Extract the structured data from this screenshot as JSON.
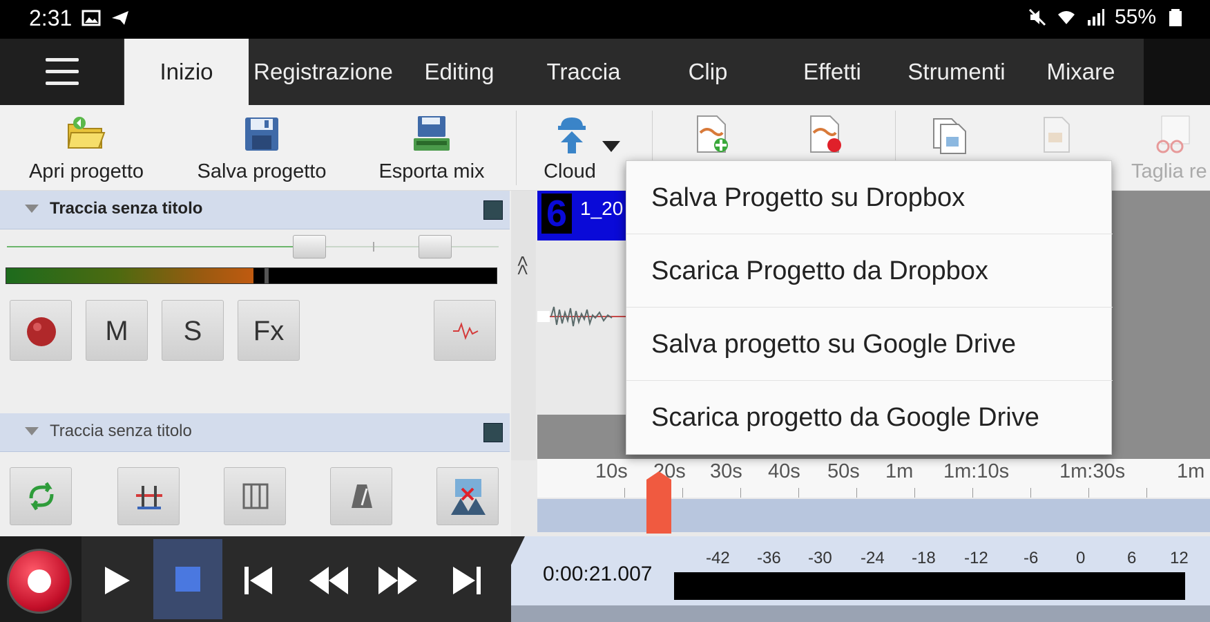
{
  "status_bar": {
    "time": "2:31",
    "battery": "55%",
    "icons": [
      "image-icon",
      "send-icon",
      "mute-icon",
      "wifi-icon",
      "signal-icon",
      "battery-icon"
    ]
  },
  "tabs": [
    {
      "label": "Inizio",
      "active": true
    },
    {
      "label": "Registrazione",
      "active": false
    },
    {
      "label": "Editing",
      "active": false
    },
    {
      "label": "Traccia",
      "active": false
    },
    {
      "label": "Clip",
      "active": false
    },
    {
      "label": "Effetti",
      "active": false
    },
    {
      "label": "Strumenti",
      "active": false
    },
    {
      "label": "Mixare",
      "active": false
    }
  ],
  "toolbar": {
    "open_project": "Apri progetto",
    "save_project": "Salva progetto",
    "export_mix": "Esporta mix",
    "cloud": "Cloud",
    "cut_partial": "Taglia re"
  },
  "tracks": [
    {
      "title": "Traccia senza titolo",
      "buttons": {
        "mute": "M",
        "solo": "S",
        "fx": "Fx"
      }
    },
    {
      "title": "Traccia senza titolo"
    }
  ],
  "clip": {
    "number": "6",
    "name": "1_20"
  },
  "cloud_menu": {
    "items": [
      "Salva Progetto su Dropbox",
      "Scarica Progetto da Dropbox",
      "Salva progetto su Google Drive",
      "Scarica progetto da Google Drive"
    ]
  },
  "ruler": {
    "labels": [
      "10s",
      "20s",
      "30s",
      "40s",
      "50s",
      "1m",
      "1m:10s",
      "1m:30s",
      "1m"
    ]
  },
  "transport": {
    "time": "0:00:21.007",
    "vu_scale": [
      "-42",
      "-36",
      "-30",
      "-24",
      "-18",
      "-12",
      "-6",
      "0",
      "6",
      "12"
    ]
  },
  "colors": {
    "accent_blue": "#0a0ad8",
    "record_red": "#c4102a",
    "playhead": "#f05a40",
    "menu_bg": "#fafafa"
  }
}
